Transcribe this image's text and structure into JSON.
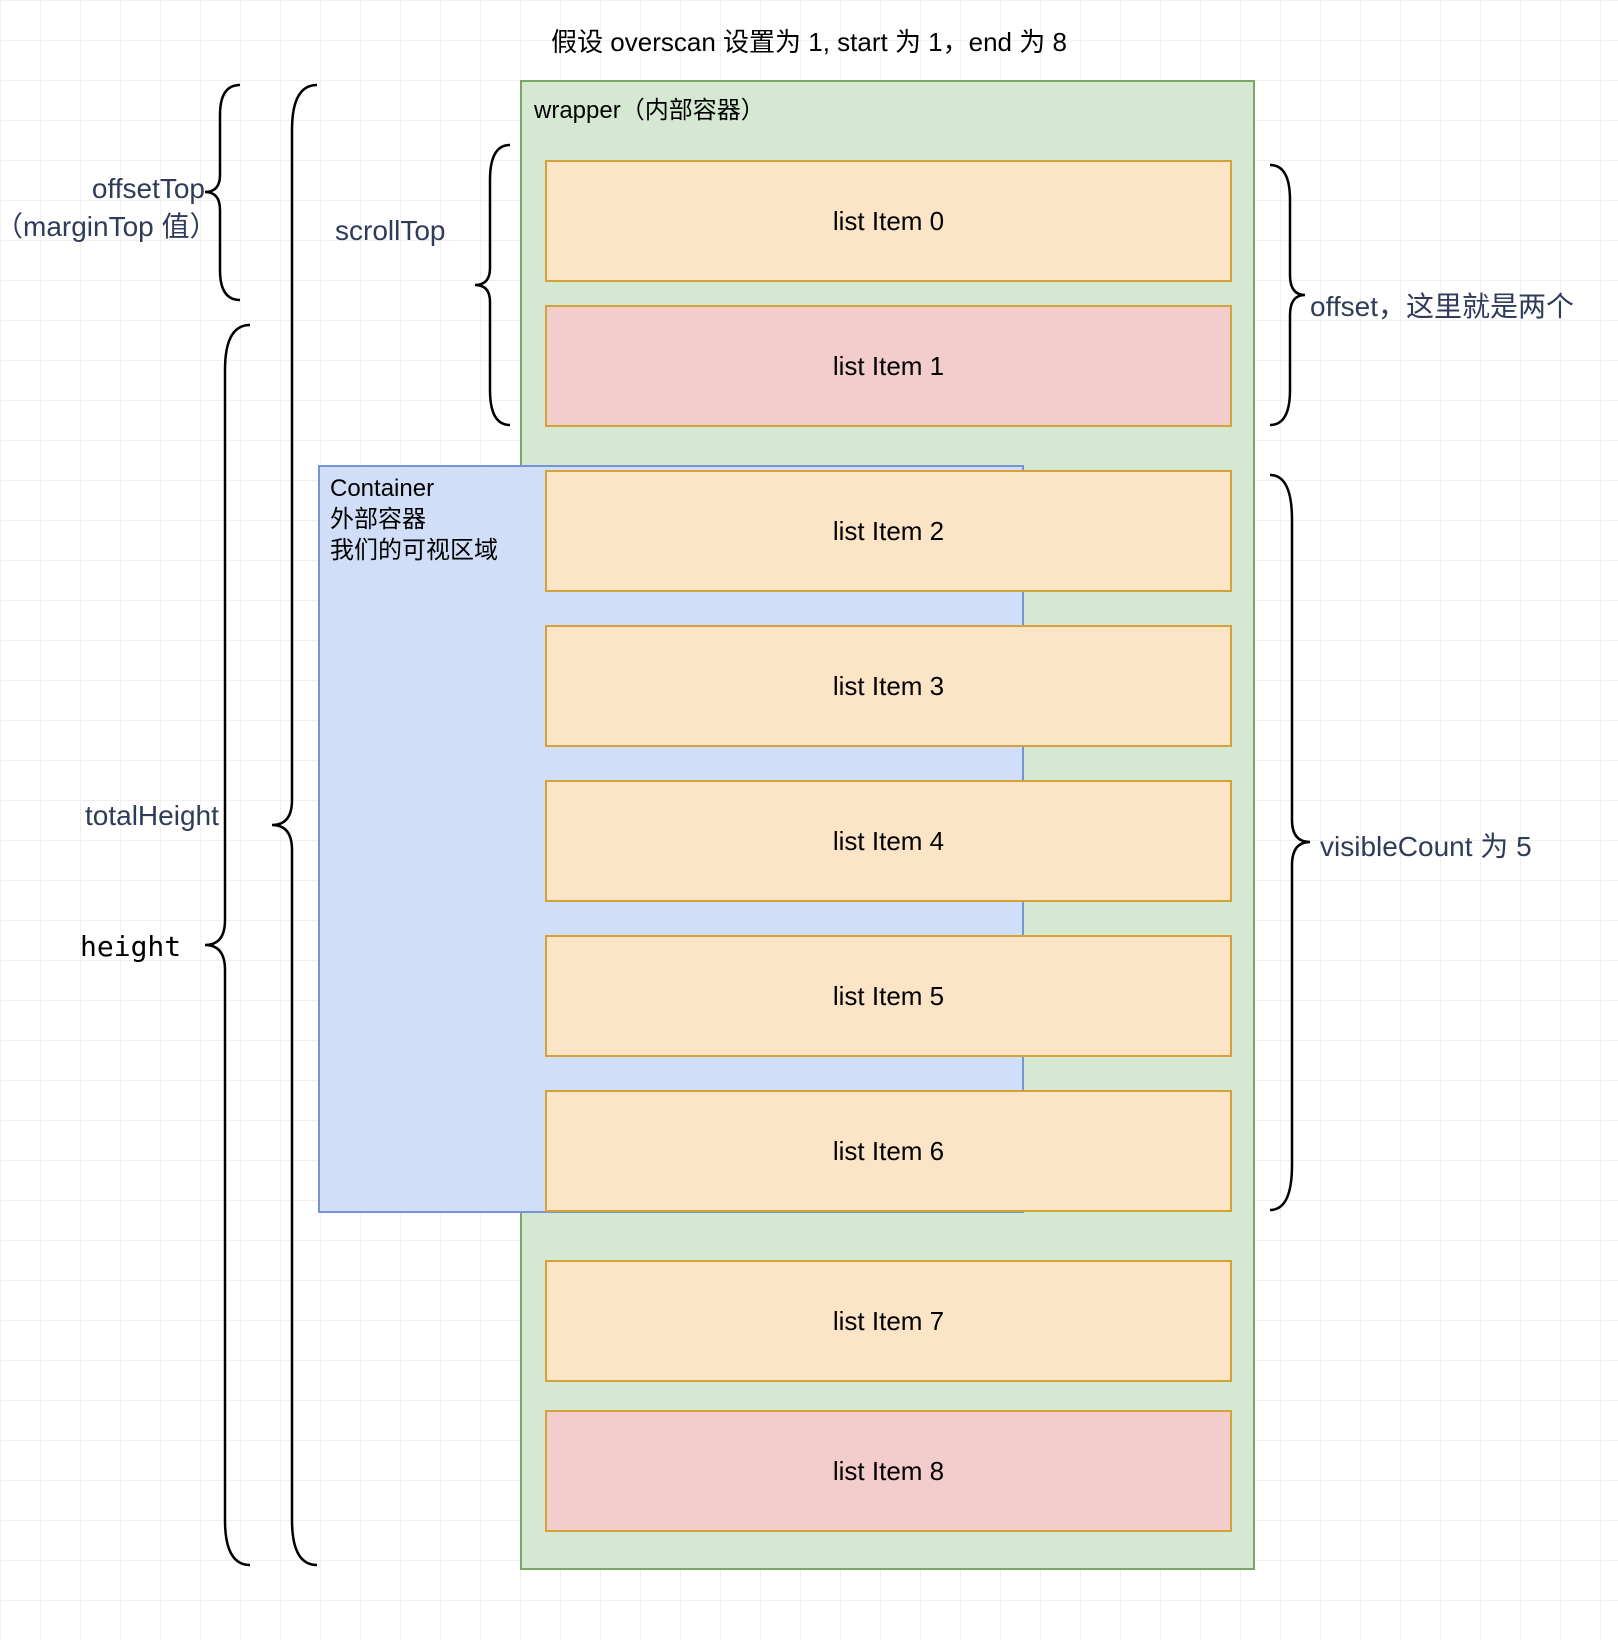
{
  "title": "假设 overscan 设置为 1, start 为 1，end 为 8",
  "wrapper": {
    "label": "wrapper（内部容器）"
  },
  "container": {
    "label": "Container\n外部容器\n我们的可视区域"
  },
  "items": [
    {
      "label": "list Item 0",
      "variant": "orange"
    },
    {
      "label": "list Item 1",
      "variant": "red"
    },
    {
      "label": "list Item 2",
      "variant": "orange"
    },
    {
      "label": "list Item 3",
      "variant": "orange"
    },
    {
      "label": "list Item 4",
      "variant": "orange"
    },
    {
      "label": "list Item 5",
      "variant": "orange"
    },
    {
      "label": "list Item 6",
      "variant": "orange"
    },
    {
      "label": "list Item 7",
      "variant": "orange"
    },
    {
      "label": "list Item 8",
      "variant": "red"
    }
  ],
  "labels": {
    "offsetTop": "offsetTop\n（marginTop 值）",
    "scrollTop": "scrollTop",
    "totalHeight": "totalHeight",
    "height": "height",
    "offset": "offset，这里就是两个",
    "visibleCount": "visibleCount 为 5"
  },
  "diagram_data": {
    "overscan": 1,
    "start": 1,
    "end": 8,
    "visibleCount": 5,
    "offsetItems": 2,
    "measurements": [
      "offsetTop",
      "scrollTop",
      "totalHeight",
      "height",
      "offset",
      "visibleCount"
    ]
  }
}
